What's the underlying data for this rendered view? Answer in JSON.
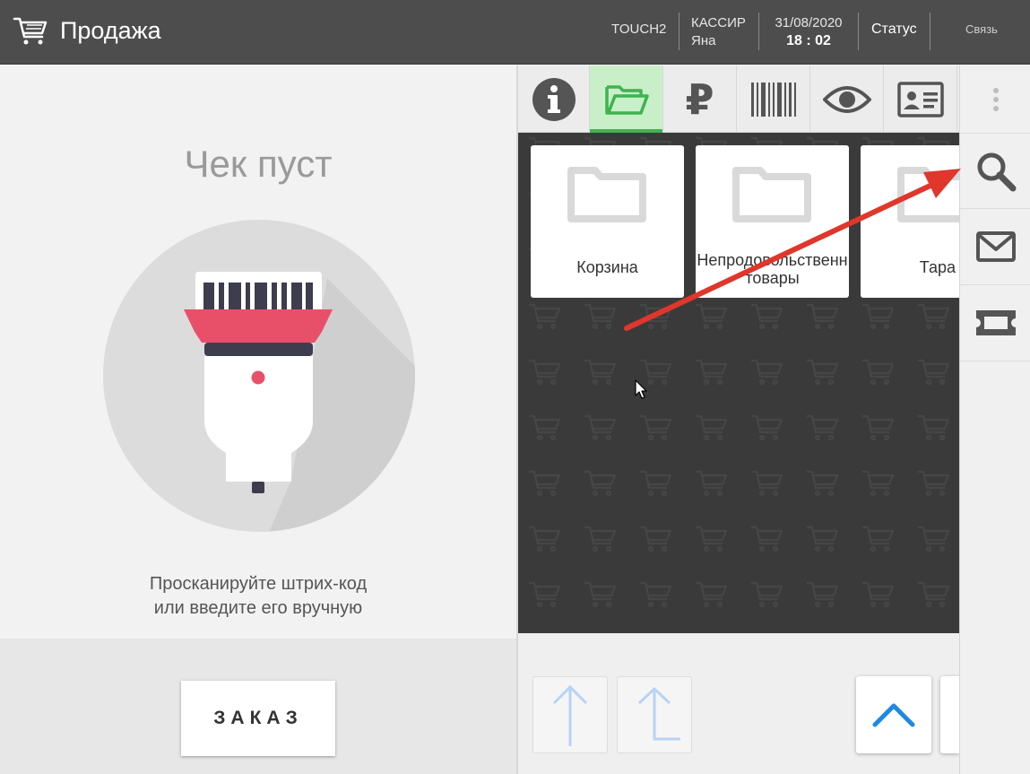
{
  "header": {
    "title": "Продажа",
    "terminal": "TOUCH2",
    "cashier_label": "КАССИР",
    "cashier_name": "Яна",
    "date": "31/08/2020",
    "time": "18 : 02",
    "status": "Статус",
    "link": "Связь"
  },
  "receipt": {
    "empty_title": "Чек пуст",
    "hint_line1": "Просканируйте штрих-код",
    "hint_line2": "или введите его вручную",
    "order_button": "ЗАКАЗ"
  },
  "tabs": [
    {
      "icon": "info-icon"
    },
    {
      "icon": "folder-open-icon",
      "active": true
    },
    {
      "icon": "ruble-icon",
      "glyph": "₽"
    },
    {
      "icon": "barcode-icon"
    },
    {
      "icon": "eye-icon"
    },
    {
      "icon": "id-card-icon"
    }
  ],
  "groups": [
    {
      "label": "Корзина"
    },
    {
      "label_line1": "Непродовольственн",
      "label_line2": "товары"
    },
    {
      "label": "Тара"
    }
  ],
  "rail": [
    {
      "icon": "more-vertical-icon"
    },
    {
      "icon": "search-icon"
    },
    {
      "icon": "mail-icon"
    },
    {
      "icon": "ticket-icon"
    }
  ],
  "colors": {
    "topbar": "#4d4d4d",
    "active_tab": "#c9efc9",
    "active_tab_bar": "#3fb34f",
    "grid_bg": "#3a3a3a",
    "scanner_red": "#e8506a",
    "annotation_arrow": "#e0362c",
    "nav_arrow_blue": "#1e88e5"
  }
}
